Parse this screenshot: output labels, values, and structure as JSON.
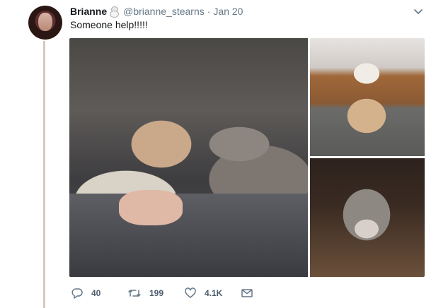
{
  "tweet": {
    "display_name": "Brianne",
    "handle": "@brianne_stearns",
    "separator": "·",
    "date": "Jan 20",
    "text": "Someone help!!!!!"
  },
  "media": {
    "photos": [
      {
        "subject": "two puppies lying on lap",
        "icon": "photo"
      },
      {
        "subject": "tan and white puppy sitting",
        "icon": "photo"
      },
      {
        "subject": "grey puppy close-up",
        "icon": "photo"
      }
    ]
  },
  "actions": {
    "reply_count": "40",
    "retweet_count": "199",
    "like_count": "4.1K"
  },
  "icons": {
    "reply": "reply-icon",
    "retweet": "retweet-icon",
    "like": "heart-icon",
    "message": "envelope-icon",
    "menu": "chevron-down-icon"
  },
  "colors": {
    "action_gray": "#657786",
    "thread_line": "#d9c7bf"
  }
}
